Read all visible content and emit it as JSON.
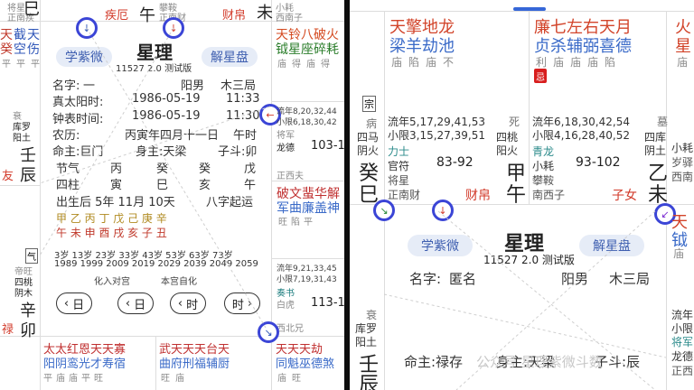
{
  "left": {
    "title": "星理",
    "subtitle": "11527 2.0 测试版",
    "btn_ziwei": "学紫微",
    "btn_jiexing": "解星盘",
    "top_left_branch": "巳",
    "top_left_sub": "正南疾",
    "top_left_label": "将星",
    "top_mid_label": "疾厄",
    "top_mid_branch": "午",
    "top_mid_sub1": "攀鞍",
    "top_mid_sub2": "正南财",
    "top_right_label": "财帛",
    "top_right_branch": "未",
    "top_right_sub": "西南子",
    "top_right_label2": "小耗",
    "stars_top_left": [
      "天",
      "截",
      "天"
    ],
    "stars_top_left2": [
      "癸",
      "空",
      "伤"
    ],
    "stars_top_left3": [
      "平",
      "平",
      "平"
    ],
    "stars_top_right1": "天铃八破火",
    "stars_top_right2": "钺星座碎耗",
    "stars_top_right3": "庙得庙得",
    "info_rows": [
      {
        "k": "名字:",
        "v1": "一",
        "v2": "阳男",
        "v3": "木三局"
      },
      {
        "k": "真太阳时:",
        "v1": "1986-05-19",
        "v2": "",
        "v3": "11:33"
      },
      {
        "k": "钟表时间:",
        "v1": "1986-05-19",
        "v2": "",
        "v3": "11:30"
      },
      {
        "k": "农历:",
        "v1": "丙寅年四月十一日",
        "v2": "",
        "v3": "午时"
      },
      {
        "k": "命主:巨门",
        "v1": "身主:天梁",
        "v2": "",
        "v3": "子斗:卯"
      }
    ],
    "pillars_head": [
      "节气",
      "丙",
      "癸",
      "癸",
      "戊"
    ],
    "pillars_row": [
      "四柱",
      "寅",
      "巳",
      "亥",
      "午"
    ],
    "qiyun": "出生后 5年 11月 10天",
    "qiyun2": "八字起运",
    "dayun_stems": "甲 乙 丙 丁 戊 己 庚 辛",
    "dayun_branches": "午 未 申 酉 戌 亥 子 丑",
    "ages": "3岁 13岁 23岁 33岁 43岁 53岁 63岁 73岁",
    "years": "1989 1999 2009 2019 2029 2039 2049 2059",
    "hua_outer": "化入对宫",
    "hua_self": "本宫自化",
    "nav_day_prev": "日",
    "nav_day_next": "日",
    "nav_hour_prev": "时",
    "nav_hour_next": "时",
    "right_mid_liunian1": "流年8,20,32,44",
    "right_mid_liunian2": "小限6,18,30,42",
    "right_mid_jiang": "将军",
    "right_mid_long": "龙德",
    "right_mid_range": "103-1",
    "right_mid_xi": "正西夫",
    "right_mid_stars1": "破文蜚华解",
    "right_mid_stars2": "军曲廉盖神",
    "right_mid_stars3": "旺陷平",
    "right_low_liunian1": "流年9,21,33,45",
    "right_low_liunian2": "小限7,19,31,43",
    "right_low_zou": "奏书",
    "right_low_bai": "白虎",
    "right_low_range": "113-1",
    "right_low_xi": "西北兄",
    "left_qi": "气",
    "left_mid1": "衰",
    "left_mid2": "库罗",
    "left_mid3": "阳土",
    "left_branch1": "壬",
    "left_branch2": "辰",
    "left_you": "友",
    "left_low1": "帝旺",
    "left_low2": "四桃",
    "left_low3": "阴木",
    "left_low_b1": "辛",
    "left_low_b2": "卯",
    "left_lu": "禄",
    "bottom_stars_l1": "太太红恩天天寡",
    "bottom_stars_l2": "阳阴鸾光才寿宿",
    "bottom_stars_l3": "平庙庙平旺",
    "bottom_stars_r1": "武天天天台天",
    "bottom_stars_r2": "曲府刑福辅厨",
    "bottom_stars_r3": "旺庙",
    "bottom_stars_x1": "天天天劫",
    "bottom_stars_x2": "同魁巫德煞",
    "bottom_stars_x3": "庙旺"
  },
  "right": {
    "title": "星理",
    "subtitle": "11527 2.0 测试版",
    "btn_ziwei": "学紫微",
    "btn_jiexing": "解星盘",
    "palace1_stars1": "天擎地龙",
    "palace1_stars2": "梁羊劫池",
    "palace1_stars3": "庙陷庙不",
    "palace2_stars1": "廉七左右天月",
    "palace2_stars2": "贞杀辅弼喜德",
    "palace2_stars3": "利庙庙庙陷",
    "palace3_stars1": "火",
    "palace3_stars2": "星",
    "palace3_stars3": "庙",
    "seal": "忌",
    "zong": "宗",
    "p1_side1": "病",
    "p1_side2": "四马",
    "p1_side3": "阴火",
    "p1_stem": "癸",
    "p1_branch": "巳",
    "p1_liunian1": "流年5,17,29,41,53",
    "p1_liunian2": "小限3,15,27,39,51",
    "p1_lishi": "力士",
    "p1_guanfu": "官符",
    "p1_jiangxing": "将星",
    "p1_range": "83-92",
    "p1_dir": "正南财",
    "p1_palace": "财帛",
    "p2_side1": "死",
    "p2_side2": "四桃",
    "p2_side3": "阳火",
    "p2_stem": "甲",
    "p2_branch": "午",
    "p2_liunian1": "流年6,18,30,42,54",
    "p2_liunian2": "小限4,16,28,40,52",
    "p2_qinglong": "青龙",
    "p2_xiaohao": "小耗",
    "p2_panan": "攀鞍",
    "p2_range": "93-102",
    "p2_dir": "南西子",
    "p2_palace": "子女",
    "p3_side1": "墓",
    "p3_side2": "四库",
    "p3_side3": "阴土",
    "p3_stem": "乙",
    "p3_branch": "未",
    "p3_small1": "小耗",
    "p3_small2": "岁驿",
    "p3_small3": "西南",
    "name_label": "名字:",
    "name_value": "匿名",
    "gender": "阳男",
    "ju": "木三局",
    "mingzhu": "命主:禄存",
    "shenzhu": "身主:天梁",
    "zidou": "子斗:辰",
    "left_side1": "衰",
    "left_side2": "库罗",
    "left_side3": "阳土",
    "left_stem": "壬",
    "left_branch": "辰",
    "watermark": "公众号 星理紫微斗数",
    "right_side1": "流年",
    "right_side2": "小限",
    "right_side3": "将军",
    "right_side4": "龙德",
    "right_side5": "正西",
    "right_star1": "天",
    "right_star2": "钺",
    "right_star3": "庙"
  }
}
